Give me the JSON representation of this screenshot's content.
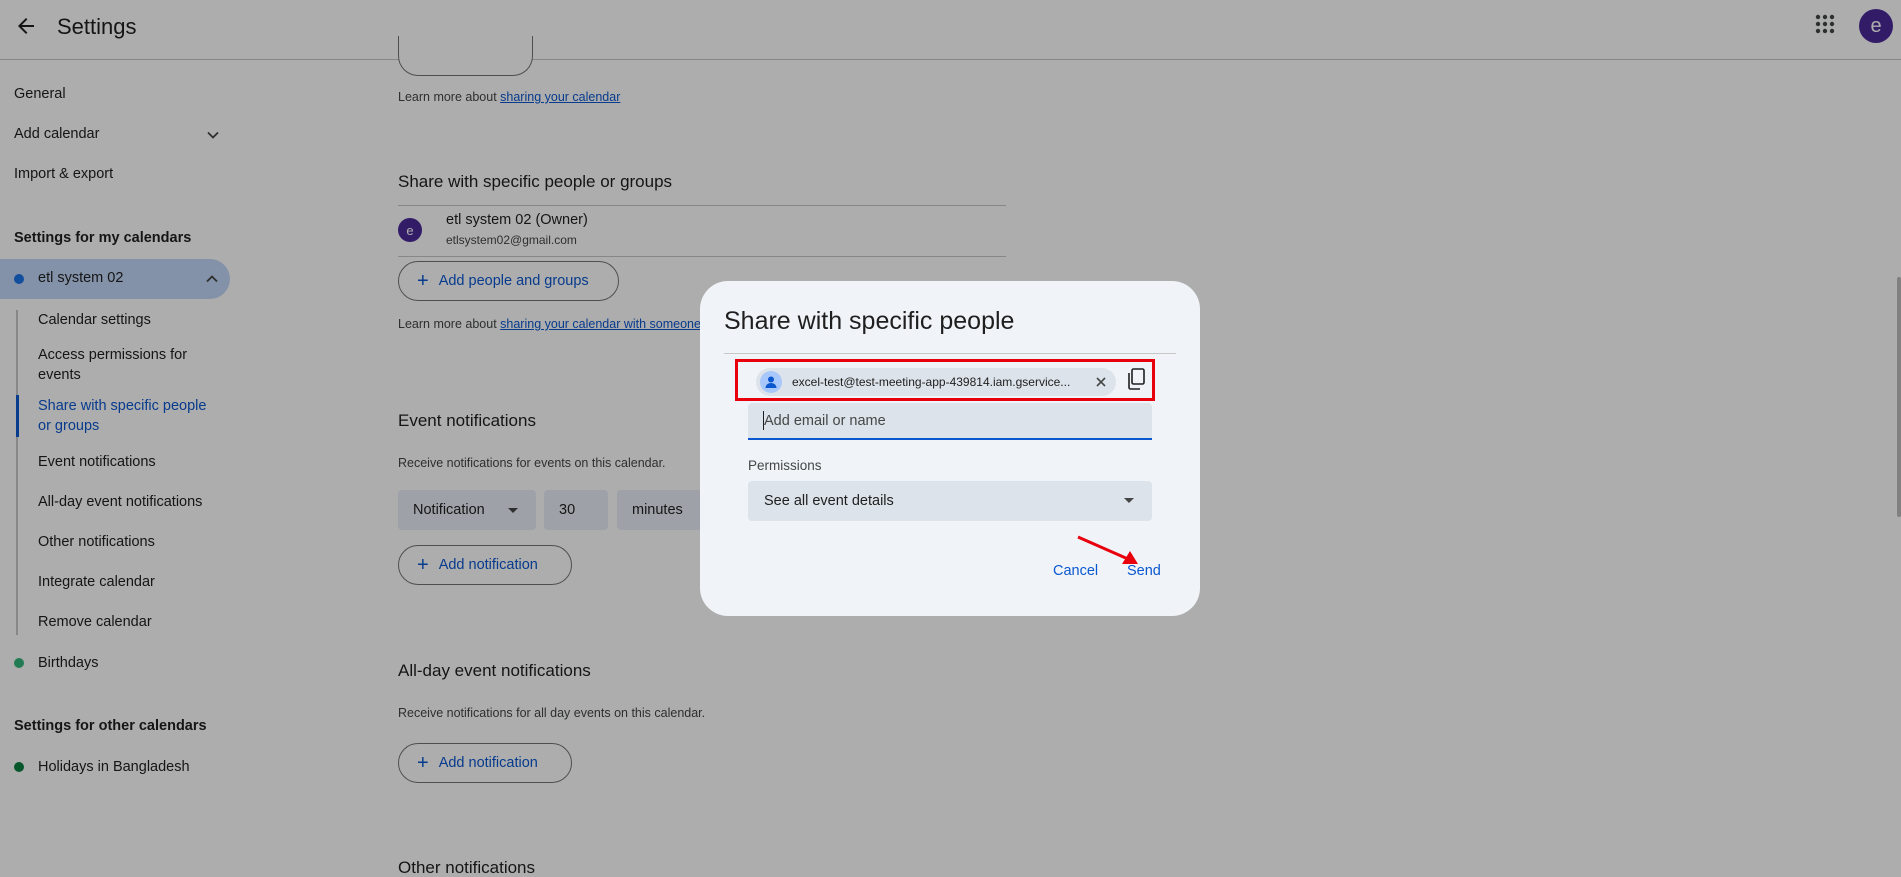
{
  "header": {
    "title": "Settings",
    "avatar_letter": "e"
  },
  "sidebar": {
    "general": "General",
    "add_calendar": "Add calendar",
    "import_export": "Import & export",
    "my_calendars_heading": "Settings for my calendars",
    "active_calendar": "etl system 02",
    "sub_items": [
      "Calendar settings",
      "Access permissions for events",
      "Share with specific people or groups",
      "Event notifications",
      "All-day event notifications",
      "Other notifications",
      "Integrate calendar",
      "Remove calendar"
    ],
    "birthdays": "Birthdays",
    "other_calendars_heading": "Settings for other calendars",
    "holidays": "Holidays in Bangladesh"
  },
  "main": {
    "learn_more_prefix": "Learn more about ",
    "sharing_link": "sharing your calendar",
    "share_heading": "Share with specific people or groups",
    "owner_avatar": "e",
    "owner_name": "etl system 02 (Owner)",
    "owner_email": "etlsystem02@gmail.com",
    "add_people_button": "Add people and groups",
    "sharing_someone_link": "sharing your calendar with someone",
    "event_notifications_heading": "Event notifications",
    "event_notifications_desc": "Receive notifications for events on this calendar.",
    "notification_type": "Notification",
    "notification_value": "30",
    "notification_unit": "minutes",
    "add_notification_button": "Add notification",
    "allday_heading": "All-day event notifications",
    "allday_desc": "Receive notifications for all day events on this calendar.",
    "other_notifications_heading": "Other notifications"
  },
  "dialog": {
    "title": "Share with specific people",
    "chip_email": "excel-test@test-meeting-app-439814.iam.gservice...",
    "input_placeholder": "Add email or name",
    "permissions_label": "Permissions",
    "permission_value": "See all event details",
    "cancel_button": "Cancel",
    "send_button": "Send"
  },
  "colors": {
    "accent": "#0b57d0",
    "active_calendar_dot": "#1a73e8",
    "birthdays_dot": "#33b679",
    "holidays_dot": "#0b8043",
    "avatar": "#4a2a99",
    "highlight": "#e8000d"
  },
  "icons": [
    "back-arrow-icon",
    "apps-grid-icon",
    "chevron-down-icon",
    "chevron-up-icon",
    "plus-icon",
    "person-icon",
    "close-icon",
    "copy-icon",
    "dropdown-arrow-icon"
  ]
}
